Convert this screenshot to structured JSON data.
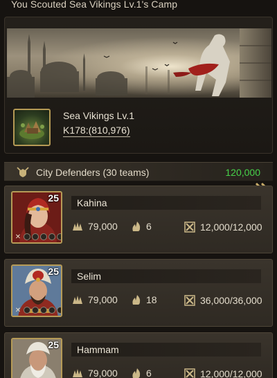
{
  "report": {
    "title": "You Scouted Sea Vikings Lv.1's Camp",
    "target_name": "Sea Vikings Lv.1",
    "target_coord": "K178:(810,976)"
  },
  "defenders_section": {
    "title": "City Defenders (30 teams)",
    "value": "120,000",
    "value_color": "#47d24a"
  },
  "defenders": [
    {
      "name": "Kahina",
      "level": "25",
      "troops": "79,000",
      "marches": "6",
      "capacity": "12,000/12,000"
    },
    {
      "name": "Selim",
      "level": "25",
      "troops": "79,000",
      "marches": "18",
      "capacity": "36,000/36,000"
    },
    {
      "name": "Hammam",
      "level": "25",
      "troops": "79,000",
      "marches": "6",
      "capacity": "12,000/12,000"
    }
  ],
  "icons": {
    "section": "swords-shield-icon",
    "troops": "soldiers-icon",
    "marches": "flame-icon",
    "capacity": "crossed-swords-icon",
    "expand": "double-chevron-right-icon"
  }
}
